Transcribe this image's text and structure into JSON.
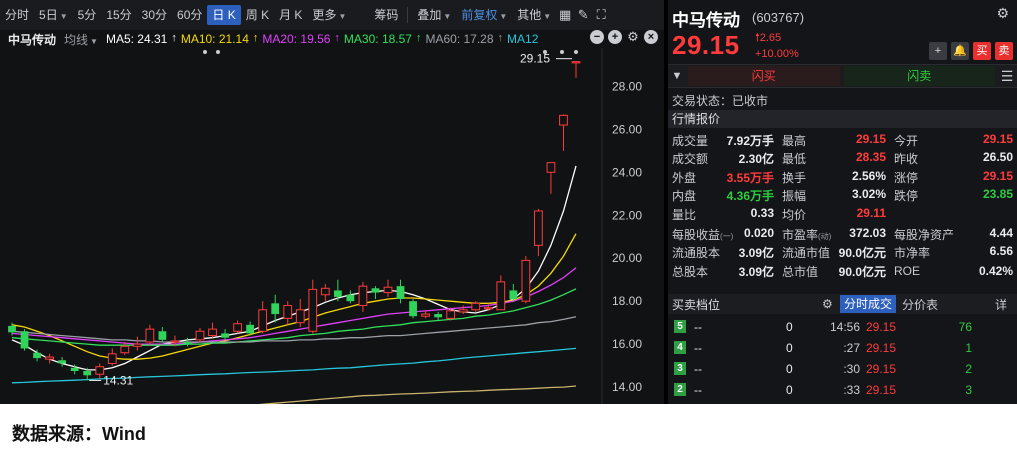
{
  "toolbar": {
    "periods": [
      "分时",
      "5日",
      "5分",
      "15分",
      "30分",
      "60分",
      "日 K",
      "周 K",
      "月 K",
      "更多"
    ],
    "active_period": "日 K",
    "chip": "筹码",
    "overlay": "叠加",
    "fq": "前复权",
    "other": "其他"
  },
  "ma_legend": {
    "stock_name": "中马传动",
    "junxian": "均线",
    "items": [
      {
        "label": "MA5: 24.31",
        "color": "#ffffff"
      },
      {
        "label": "MA10: 21.14",
        "color": "#f5d90a"
      },
      {
        "label": "MA20: 19.56",
        "color": "#e040fb"
      },
      {
        "label": "MA30: 18.57",
        "color": "#32e05a"
      },
      {
        "label": "MA60: 17.28",
        "color": "#9aa0a6"
      },
      {
        "label": "MA12",
        "color": "#26c6da"
      }
    ]
  },
  "chart_data": {
    "type": "candlestick",
    "y_ticks": [
      "28.00",
      "26.00",
      "24.00",
      "22.00",
      "20.00",
      "18.00",
      "16.00",
      "14.00"
    ],
    "ylim": [
      13.4,
      29.6
    ],
    "annotations": {
      "high": "29.15",
      "low": "14.31"
    },
    "candles": [
      {
        "o": 16.85,
        "c": 16.55,
        "h": 17.0,
        "l": 16.4
      },
      {
        "o": 16.6,
        "c": 15.8,
        "h": 16.7,
        "l": 15.7
      },
      {
        "o": 15.6,
        "c": 15.35,
        "h": 15.75,
        "l": 15.2
      },
      {
        "o": 15.3,
        "c": 15.4,
        "h": 15.55,
        "l": 15.1
      },
      {
        "o": 15.25,
        "c": 15.1,
        "h": 15.4,
        "l": 14.95
      },
      {
        "o": 14.9,
        "c": 14.75,
        "h": 15.05,
        "l": 14.6
      },
      {
        "o": 14.75,
        "c": 14.55,
        "h": 14.9,
        "l": 14.31
      },
      {
        "o": 14.6,
        "c": 14.95,
        "h": 15.1,
        "l": 14.4
      },
      {
        "o": 15.1,
        "c": 15.55,
        "h": 15.8,
        "l": 15.0
      },
      {
        "o": 15.6,
        "c": 15.9,
        "h": 16.1,
        "l": 15.5
      },
      {
        "o": 15.9,
        "c": 16.0,
        "h": 16.35,
        "l": 15.7
      },
      {
        "o": 16.1,
        "c": 16.7,
        "h": 16.9,
        "l": 15.95
      },
      {
        "o": 16.6,
        "c": 16.2,
        "h": 16.8,
        "l": 16.1
      },
      {
        "o": 16.1,
        "c": 16.15,
        "h": 16.4,
        "l": 15.9
      },
      {
        "o": 16.1,
        "c": 16.0,
        "h": 16.3,
        "l": 15.9
      },
      {
        "o": 16.2,
        "c": 16.6,
        "h": 16.75,
        "l": 16.1
      },
      {
        "o": 16.4,
        "c": 16.7,
        "h": 17.0,
        "l": 16.3
      },
      {
        "o": 16.5,
        "c": 16.3,
        "h": 16.7,
        "l": 16.2
      },
      {
        "o": 16.6,
        "c": 16.95,
        "h": 17.1,
        "l": 16.5
      },
      {
        "o": 16.9,
        "c": 16.5,
        "h": 17.05,
        "l": 16.4
      },
      {
        "o": 16.6,
        "c": 17.6,
        "h": 18.0,
        "l": 16.5
      },
      {
        "o": 17.9,
        "c": 17.4,
        "h": 18.3,
        "l": 17.0
      },
      {
        "o": 17.2,
        "c": 17.8,
        "h": 18.0,
        "l": 16.9
      },
      {
        "o": 17.0,
        "c": 17.6,
        "h": 18.1,
        "l": 16.8
      },
      {
        "o": 16.6,
        "c": 18.55,
        "h": 19.0,
        "l": 16.5
      },
      {
        "o": 18.3,
        "c": 18.6,
        "h": 18.8,
        "l": 18.0
      },
      {
        "o": 18.5,
        "c": 18.2,
        "h": 19.0,
        "l": 18.0
      },
      {
        "o": 18.3,
        "c": 18.0,
        "h": 18.5,
        "l": 17.9
      },
      {
        "o": 17.8,
        "c": 18.7,
        "h": 18.9,
        "l": 17.5
      },
      {
        "o": 18.6,
        "c": 18.4,
        "h": 18.7,
        "l": 18.1
      },
      {
        "o": 18.4,
        "c": 18.65,
        "h": 19.0,
        "l": 18.2
      },
      {
        "o": 18.7,
        "c": 18.1,
        "h": 19.0,
        "l": 17.9
      },
      {
        "o": 18.0,
        "c": 17.3,
        "h": 18.1,
        "l": 17.2
      },
      {
        "o": 17.3,
        "c": 17.4,
        "h": 17.55,
        "l": 17.2
      },
      {
        "o": 17.4,
        "c": 17.25,
        "h": 17.5,
        "l": 17.1
      },
      {
        "o": 17.2,
        "c": 17.55,
        "h": 17.7,
        "l": 17.1
      },
      {
        "o": 17.5,
        "c": 17.6,
        "h": 17.8,
        "l": 17.4
      },
      {
        "o": 17.6,
        "c": 17.9,
        "h": 18.0,
        "l": 17.5
      },
      {
        "o": 17.7,
        "c": 17.7,
        "h": 17.9,
        "l": 17.55
      },
      {
        "o": 17.6,
        "c": 18.9,
        "h": 19.2,
        "l": 17.6
      },
      {
        "o": 18.5,
        "c": 18.1,
        "h": 18.8,
        "l": 18.0
      },
      {
        "o": 18.0,
        "c": 19.9,
        "h": 20.1,
        "l": 17.9
      },
      {
        "o": 20.6,
        "c": 22.2,
        "h": 22.3,
        "l": 20.1
      },
      {
        "o": 24.0,
        "c": 24.45,
        "h": 24.45,
        "l": 23.0
      },
      {
        "o": 26.2,
        "c": 26.65,
        "h": 26.7,
        "l": 25.0
      },
      {
        "o": 29.15,
        "c": 29.15,
        "h": 29.15,
        "l": 28.4
      }
    ],
    "ma_lines": [
      {
        "name": "MA5",
        "color": "#ffffff",
        "values": [
          16.2,
          15.95,
          15.6,
          15.3,
          15.1,
          14.95,
          14.8,
          14.8,
          14.9,
          15.1,
          15.4,
          15.7,
          16.0,
          16.1,
          16.2,
          16.25,
          16.3,
          16.4,
          16.5,
          16.6,
          16.85,
          17.1,
          17.3,
          17.5,
          17.7,
          17.95,
          18.15,
          18.3,
          18.4,
          18.45,
          18.5,
          18.45,
          18.3,
          18.1,
          17.85,
          17.6,
          17.5,
          17.45,
          17.6,
          17.85,
          18.1,
          18.6,
          19.4,
          20.6,
          22.2,
          24.3
        ]
      },
      {
        "name": "MA10",
        "color": "#f5d90a",
        "values": [
          16.9,
          16.8,
          16.6,
          16.4,
          16.15,
          15.9,
          15.65,
          15.45,
          15.35,
          15.3,
          15.3,
          15.35,
          15.45,
          15.6,
          15.75,
          15.9,
          16.05,
          16.15,
          16.3,
          16.45,
          16.6,
          16.75,
          16.9,
          17.05,
          17.25,
          17.45,
          17.6,
          17.75,
          17.9,
          18.0,
          18.1,
          18.15,
          18.15,
          18.1,
          18.05,
          18.0,
          17.95,
          17.9,
          17.9,
          17.95,
          18.05,
          18.3,
          18.7,
          19.3,
          20.1,
          21.14
        ]
      },
      {
        "name": "MA20",
        "color": "#e040fb",
        "values": [
          16.5,
          16.45,
          16.4,
          16.35,
          16.3,
          16.25,
          16.2,
          16.15,
          16.1,
          16.05,
          16.0,
          16.0,
          16.0,
          16.0,
          16.05,
          16.1,
          16.15,
          16.2,
          16.25,
          16.3,
          16.4,
          16.5,
          16.6,
          16.7,
          16.8,
          16.9,
          17.0,
          17.1,
          17.2,
          17.3,
          17.4,
          17.45,
          17.5,
          17.55,
          17.6,
          17.65,
          17.7,
          17.75,
          17.8,
          17.9,
          18.0,
          18.2,
          18.45,
          18.75,
          19.1,
          19.56
        ]
      },
      {
        "name": "MA30",
        "color": "#32e05a",
        "values": [
          16.3,
          16.25,
          16.2,
          16.15,
          16.1,
          16.05,
          16.0,
          15.95,
          15.95,
          15.95,
          15.95,
          15.95,
          15.95,
          15.95,
          16.0,
          16.0,
          16.05,
          16.05,
          16.1,
          16.15,
          16.2,
          16.25,
          16.3,
          16.4,
          16.45,
          16.5,
          16.6,
          16.65,
          16.7,
          16.8,
          16.85,
          16.9,
          17.0,
          17.05,
          17.1,
          17.15,
          17.2,
          17.3,
          17.35,
          17.45,
          17.55,
          17.7,
          17.85,
          18.05,
          18.3,
          18.57
        ]
      },
      {
        "name": "MA60",
        "color": "#9aa0a6",
        "values": [
          16.6,
          16.55,
          16.5,
          16.45,
          16.4,
          16.35,
          16.3,
          16.25,
          16.2,
          16.2,
          16.15,
          16.15,
          16.1,
          16.1,
          16.1,
          16.1,
          16.1,
          16.1,
          16.1,
          16.1,
          16.15,
          16.15,
          16.15,
          16.2,
          16.2,
          16.25,
          16.25,
          16.3,
          16.3,
          16.35,
          16.4,
          16.4,
          16.45,
          16.5,
          16.55,
          16.6,
          16.65,
          16.7,
          16.75,
          16.8,
          16.85,
          16.9,
          17.0,
          17.05,
          17.15,
          17.28
        ]
      },
      {
        "name": "MA12",
        "color": "#26c6da",
        "values": [
          14.2,
          14.22,
          14.25,
          14.28,
          14.3,
          14.32,
          14.35,
          14.38,
          14.4,
          14.42,
          14.45,
          14.48,
          14.5,
          14.52,
          14.55,
          14.58,
          14.6,
          14.62,
          14.65,
          14.68,
          14.7,
          14.72,
          14.75,
          14.78,
          14.8,
          14.85,
          14.88,
          14.9,
          14.95,
          15.0,
          15.05,
          15.08,
          15.12,
          15.18,
          15.22,
          15.28,
          15.35,
          15.4,
          15.45,
          15.5,
          15.55,
          15.6,
          15.65,
          15.7,
          15.75,
          15.8
        ]
      },
      {
        "name": "",
        "color": "#c9b26b",
        "values": [
          12.2,
          12.25,
          12.3,
          12.35,
          12.4,
          12.45,
          12.5,
          12.55,
          12.6,
          12.65,
          12.7,
          12.75,
          12.8,
          12.85,
          12.9,
          12.95,
          13.0,
          13.05,
          13.1,
          13.15,
          13.2,
          13.25,
          13.3,
          13.35,
          13.4,
          13.45,
          13.5,
          13.55,
          13.6,
          13.62,
          13.65,
          13.68,
          13.7,
          13.72,
          13.75,
          13.78,
          13.8,
          13.82,
          13.85,
          13.88,
          13.9,
          13.92,
          13.95,
          13.98,
          14.0,
          14.05
        ]
      }
    ]
  },
  "quote": {
    "name": "中马传动",
    "code": "(603767)",
    "price": "29.15",
    "change": "2.65",
    "change_pct": "+10.00%",
    "buy_btn": "买",
    "sell_btn": "卖",
    "flash_buy": "闪买",
    "flash_sell": "闪卖",
    "status": "交易状态：已收市",
    "section_title": "行情报价"
  },
  "stats": [
    [
      {
        "l": "成交量",
        "v": "7.92万手",
        "c": "white"
      },
      {
        "l": "最高",
        "v": "29.15",
        "c": "red"
      },
      {
        "l": "今开",
        "v": "29.15",
        "c": "red"
      }
    ],
    [
      {
        "l": "成交额",
        "v": "2.30亿",
        "c": "white"
      },
      {
        "l": "最低",
        "v": "28.35",
        "c": "red"
      },
      {
        "l": "昨收",
        "v": "26.50",
        "c": "white"
      }
    ],
    [
      {
        "l": "外盘",
        "v": "3.55万手",
        "c": "red"
      },
      {
        "l": "换手",
        "v": "2.56%",
        "c": "white"
      },
      {
        "l": "涨停",
        "v": "29.15",
        "c": "red"
      }
    ],
    [
      {
        "l": "内盘",
        "v": "4.36万手",
        "c": "green"
      },
      {
        "l": "振幅",
        "v": "3.02%",
        "c": "white"
      },
      {
        "l": "跌停",
        "v": "23.85",
        "c": "green"
      }
    ],
    [
      {
        "l": "量比",
        "v": "0.33",
        "c": "white"
      },
      {
        "l": "均价",
        "v": "29.11",
        "c": "red"
      },
      {
        "l": "",
        "v": "",
        "c": "white"
      }
    ]
  ],
  "stats2": [
    [
      {
        "l": "每股收益",
        "sub": "(一)",
        "v": "0.020"
      },
      {
        "l": "市盈率",
        "sub": "(动)",
        "v": "372.03"
      },
      {
        "l": "每股净资产",
        "v": "4.44"
      }
    ],
    [
      {
        "l": "流通股本",
        "v": "3.09亿"
      },
      {
        "l": "流通市值",
        "v": "90.0亿元"
      },
      {
        "l": "市净率",
        "v": "6.56"
      }
    ],
    [
      {
        "l": "总股本",
        "v": "3.09亿"
      },
      {
        "l": "总市值",
        "v": "90.0亿元"
      },
      {
        "l": "ROE",
        "v": "0.42%"
      }
    ]
  ],
  "orderbook": {
    "title": "买卖档位",
    "tab_active": "分时成交",
    "tab2": "分价表",
    "detail": "详",
    "rows": [
      {
        "lvl": "5",
        "price": "--",
        "vol": "0",
        "time": "14:56",
        "tp": "29.15",
        "tv": "76"
      },
      {
        "lvl": "4",
        "price": "--",
        "vol": "0",
        "time": ":27",
        "tp": "29.15",
        "tv": "1"
      },
      {
        "lvl": "3",
        "price": "--",
        "vol": "0",
        "time": ":30",
        "tp": "29.15",
        "tv": "2"
      },
      {
        "lvl": "2",
        "price": "--",
        "vol": "0",
        "time": ":33",
        "tp": "29.15",
        "tv": "3"
      }
    ]
  },
  "footer": "数据来源：Wind"
}
